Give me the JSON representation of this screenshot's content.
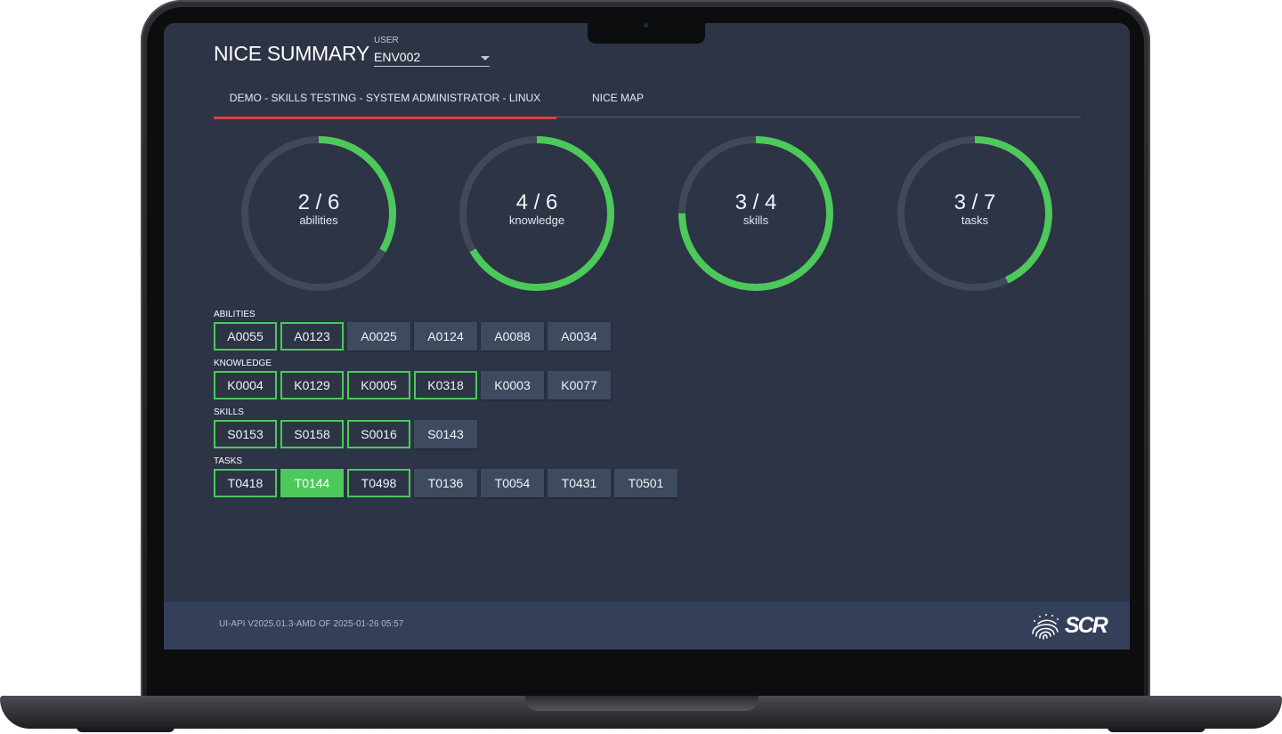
{
  "app": {
    "title": "NICE SUMMARY"
  },
  "user": {
    "label": "USER",
    "value": "ENV002"
  },
  "tabs": [
    {
      "label": "DEMO - SKILLS TESTING - SYSTEM ADMINISTRATOR - LINUX",
      "active": true
    },
    {
      "label": "NICE MAP",
      "active": false
    }
  ],
  "gauges": [
    {
      "value": "2 / 6",
      "label": "abilities",
      "fraction": 0.3333
    },
    {
      "value": "4 / 6",
      "label": "knowledge",
      "fraction": 0.6667
    },
    {
      "value": "3 / 4",
      "label": "skills",
      "fraction": 0.75
    },
    {
      "value": "3 / 7",
      "label": "tasks",
      "fraction": 0.4286
    }
  ],
  "groups": [
    {
      "label": "ABILITIES",
      "chips": [
        {
          "code": "A0055",
          "state": "met"
        },
        {
          "code": "A0123",
          "state": "met"
        },
        {
          "code": "A0025",
          "state": "unmet"
        },
        {
          "code": "A0124",
          "state": "unmet"
        },
        {
          "code": "A0088",
          "state": "unmet"
        },
        {
          "code": "A0034",
          "state": "unmet"
        }
      ]
    },
    {
      "label": "KNOWLEDGE",
      "chips": [
        {
          "code": "K0004",
          "state": "met"
        },
        {
          "code": "K0129",
          "state": "met"
        },
        {
          "code": "K0005",
          "state": "met"
        },
        {
          "code": "K0318",
          "state": "met"
        },
        {
          "code": "K0003",
          "state": "unmet"
        },
        {
          "code": "K0077",
          "state": "unmet"
        }
      ]
    },
    {
      "label": "SKILLS",
      "chips": [
        {
          "code": "S0153",
          "state": "met"
        },
        {
          "code": "S0158",
          "state": "met"
        },
        {
          "code": "S0016",
          "state": "met"
        },
        {
          "code": "S0143",
          "state": "unmet"
        }
      ]
    },
    {
      "label": "TASKS",
      "chips": [
        {
          "code": "T0418",
          "state": "met"
        },
        {
          "code": "T0144",
          "state": "selected"
        },
        {
          "code": "T0498",
          "state": "met"
        },
        {
          "code": "T0136",
          "state": "unmet"
        },
        {
          "code": "T0054",
          "state": "unmet"
        },
        {
          "code": "T0431",
          "state": "unmet"
        },
        {
          "code": "T0501",
          "state": "unmet"
        }
      ]
    }
  ],
  "footer": {
    "version": "UI-API V2025.01.3-AMD OF 2025-01-26 05:57",
    "brand": "SCR"
  },
  "colors": {
    "background": "#2c3445",
    "footer": "#34405a",
    "progress": "#4cc95a",
    "track": "#414958",
    "chip": "#3e4a5e",
    "tab_indicator": "#d9413c"
  },
  "icons": {
    "brand_logo": "fingerprint-icon",
    "user_dropdown": "chevron-down-icon"
  }
}
